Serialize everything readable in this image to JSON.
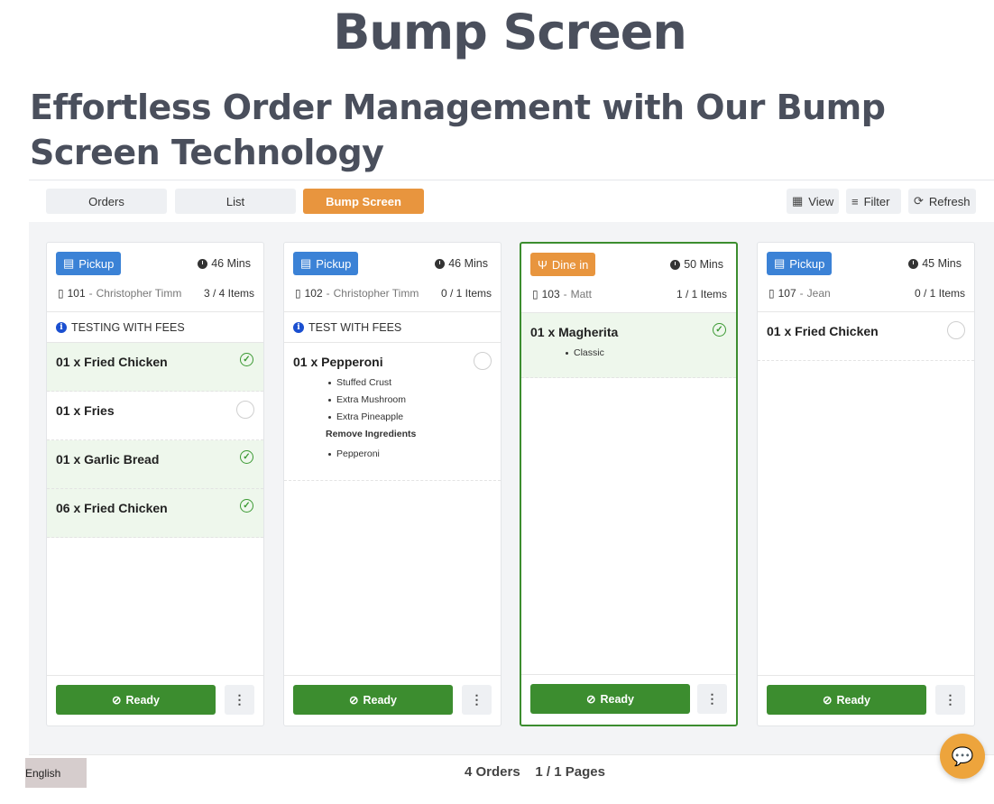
{
  "page": {
    "title": "Bump Screen",
    "subtitle": "Effortless Order Management with Our Bump Screen Technology"
  },
  "tabs": [
    "Orders",
    "List",
    "Bump Screen"
  ],
  "toolbar": {
    "view": "View",
    "filter": "Filter",
    "refresh": "Refresh"
  },
  "orders": [
    {
      "type": "Pickup",
      "mins": "46 Mins",
      "number": "101",
      "customer": "Christopher Timm",
      "count": "3 / 4 Items",
      "note": "TESTING WITH FEES",
      "items": [
        {
          "name": "01 x Fried Chicken",
          "done": true
        },
        {
          "name": "01 x Fries",
          "done": false
        },
        {
          "name": "01 x Garlic Bread",
          "done": true
        },
        {
          "name": "06 x Fried Chicken",
          "done": true
        }
      ],
      "ready": "Ready"
    },
    {
      "type": "Pickup",
      "mins": "46 Mins",
      "number": "102",
      "customer": "Christopher Timm",
      "count": "0 / 1 Items",
      "note": "TEST WITH FEES",
      "items": [
        {
          "name": "01 x Pepperoni",
          "done": false,
          "modifiers": [
            "Stuffed Crust",
            "Extra Mushroom",
            "Extra Pineapple"
          ],
          "remove_heading": "Remove Ingredients",
          "removed": [
            "Pepperoni"
          ]
        }
      ],
      "ready": "Ready"
    },
    {
      "type": "Dine in",
      "mins": "50 Mins",
      "number": "103",
      "customer": "Matt",
      "count": "1 / 1 Items",
      "items": [
        {
          "name": "01 x Magherita",
          "done": true,
          "modifiers": [
            "Classic"
          ]
        }
      ],
      "ready": "Ready"
    },
    {
      "type": "Pickup",
      "mins": "45 Mins",
      "number": "107",
      "customer": "Jean",
      "count": "0 / 1 Items",
      "items": [
        {
          "name": "01 x Fried Chicken",
          "done": false
        }
      ],
      "ready": "Ready"
    }
  ],
  "footer": {
    "orders": "4 Orders",
    "pages": "1 / 1 Pages",
    "language": "English"
  },
  "colors": {
    "accent": "#e8953e",
    "pickup": "#3b82d6",
    "ready": "#3c8d2f",
    "done_bg": "#eef7ec"
  }
}
